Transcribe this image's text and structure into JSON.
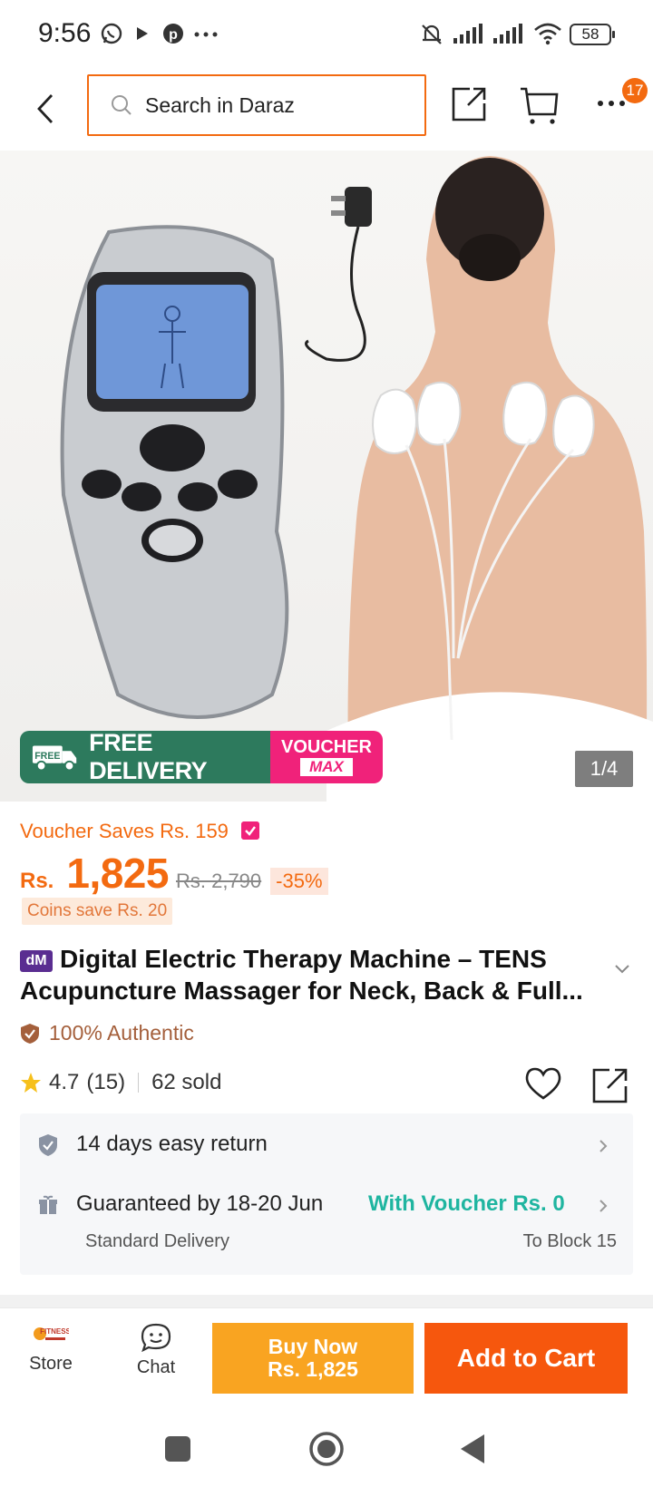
{
  "status_bar": {
    "time": "9:56",
    "battery": "58"
  },
  "search": {
    "placeholder": "Search in Daraz"
  },
  "cart_badge": "17",
  "gallery": {
    "counter": "1/4",
    "promo_free_label": "FREE",
    "promo_free_delivery": "FREE DELIVERY",
    "promo_voucher_line1": "VOUCHER",
    "promo_voucher_line2": "MAX"
  },
  "price": {
    "voucher_saves": "Voucher Saves Rs. 159",
    "currency": "Rs.",
    "amount": "1,825",
    "old_price": "Rs. 2,790",
    "discount": "-35%",
    "coins": "Coins save Rs. 20"
  },
  "product": {
    "brand_badge": "dM",
    "title": "Digital Electric Therapy Machine – TENS Acupuncture Massager for Neck, Back & Full...",
    "authentic": "100% Authentic",
    "rating": "4.7",
    "rating_count": "(15)",
    "sold": "62 sold"
  },
  "services": {
    "return_text": "14 days easy return",
    "delivery_text": "Guaranteed by 18-20 Jun",
    "delivery_type": "Standard Delivery",
    "voucher_text": "With Voucher Rs. 0",
    "location": "To Block 15"
  },
  "action_bar": {
    "store_label": "Store",
    "store_logo_text": "FITNESS",
    "chat_label": "Chat",
    "buy_now_line1": "Buy Now",
    "buy_now_line2": "Rs. 1,825",
    "add_to_cart": "Add to Cart"
  },
  "colors": {
    "accent": "#f36a10",
    "free_delivery": "#2d7a5d",
    "voucher_pink": "#f0227a",
    "buy_now": "#f9a421",
    "add_to_cart": "#f6570d",
    "teal": "#1fb5a0"
  },
  "icons": [
    "whatsapp-icon",
    "play-icon",
    "pinterest-icon",
    "more-dots-icon",
    "mute-bell-icon",
    "signal-icon",
    "wifi-icon",
    "back-arrow-icon",
    "search-icon",
    "share-icon",
    "cart-icon",
    "more-icon",
    "truck-icon",
    "shield-icon",
    "star-icon",
    "heart-icon",
    "return-shield-icon",
    "gift-icon",
    "chevron-right-icon",
    "chat-icon",
    "home-square-icon",
    "home-circle-icon",
    "back-triangle-icon"
  ]
}
